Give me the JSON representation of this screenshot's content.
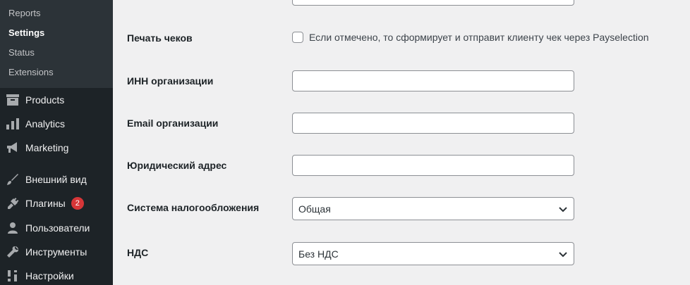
{
  "sidebar": {
    "submenu": [
      {
        "label": "Reports"
      },
      {
        "label": "Settings",
        "current": true
      },
      {
        "label": "Status"
      },
      {
        "label": "Extensions"
      }
    ],
    "items": [
      {
        "label": "Products",
        "icon": "archive-icon"
      },
      {
        "label": "Analytics",
        "icon": "bar-chart-icon"
      },
      {
        "label": "Marketing",
        "icon": "megaphone-icon"
      },
      {
        "label": "Внешний вид",
        "icon": "paintbrush-icon"
      },
      {
        "label": "Плагины",
        "icon": "plugin-icon",
        "badge": "2"
      },
      {
        "label": "Пользователи",
        "icon": "user-icon"
      },
      {
        "label": "Инструменты",
        "icon": "wrench-icon"
      },
      {
        "label": "Настройки",
        "icon": "settings-icon"
      }
    ]
  },
  "form": {
    "print_receipts": {
      "label": "Печать чеков",
      "checkbox_label": "Если отмечено, то сформирует и отправит клиенту чек через Payselection",
      "checked": false
    },
    "inn": {
      "label": "ИНН организации",
      "value": ""
    },
    "email": {
      "label": "Email организации",
      "value": ""
    },
    "address": {
      "label": "Юридический адрес",
      "value": ""
    },
    "tax_system": {
      "label": "Система налогообложения",
      "value": "Общая"
    },
    "vat": {
      "label": "НДС",
      "value": "Без НДС"
    }
  },
  "colors": {
    "sidebar_bg": "#1d2327",
    "submenu_bg": "#2c3338",
    "badge_bg": "#d63638",
    "content_bg": "#f0f0f1"
  }
}
